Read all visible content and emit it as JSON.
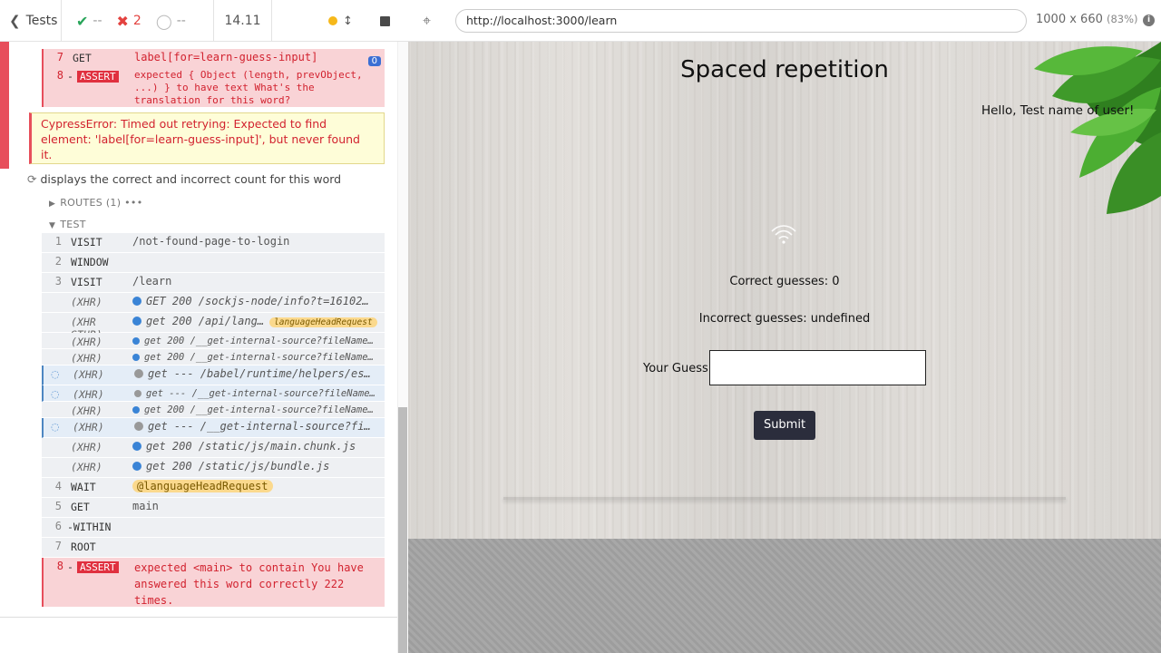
{
  "reporter": {
    "back_label": "Tests",
    "stats": {
      "passed": "--",
      "failed": "2",
      "pending": "--"
    },
    "duration": "14.11"
  },
  "commands_top": [
    {
      "num": "7",
      "name": "GET",
      "msg": "label[for=learn-guess-input]",
      "count": "0"
    },
    {
      "num": "8",
      "name": "ASSERT",
      "msg": "expected { Object (length, prevObject, ...) } to have text What's the translation for this word?"
    }
  ],
  "error": "CypressError: Timed out retrying: Expected to find element: 'label[for=learn-guess-input]', but never found it.",
  "test": {
    "title": "displays the correct and incorrect count for this word",
    "routes_label": "ROUTES (1)",
    "test_label": "TEST"
  },
  "commands": [
    {
      "num": "1",
      "name": "VISIT",
      "msg": "/not-found-page-to-login"
    },
    {
      "num": "2",
      "name": "WINDOW",
      "msg": ""
    },
    {
      "num": "3",
      "name": "VISIT",
      "msg": "/learn"
    },
    {
      "num": "",
      "name": "(XHR)",
      "msg": "GET 200 /sockjs-node/info?t=16102…"
    },
    {
      "num": "",
      "name": "(XHR STUB)",
      "msg": "get 200 /api/lang…",
      "alias": "languageHeadRequest"
    },
    {
      "num": "",
      "name": "(XHR)",
      "msg": "get 200 /__get-internal-source?fileName…"
    },
    {
      "num": "",
      "name": "(XHR)",
      "msg": "get 200 /__get-internal-source?fileName…"
    },
    {
      "num": "",
      "name": "(XHR)",
      "msg": "get --- /babel/runtime/helpers/es…"
    },
    {
      "num": "",
      "name": "(XHR)",
      "msg": "get --- /__get-internal-source?fileName…"
    },
    {
      "num": "",
      "name": "(XHR)",
      "msg": "get 200 /__get-internal-source?fileName…"
    },
    {
      "num": "",
      "name": "(XHR)",
      "msg": "get --- /__get-internal-source?fi…"
    },
    {
      "num": "",
      "name": "(XHR)",
      "msg": "get 200 /static/js/main.chunk.js"
    },
    {
      "num": "",
      "name": "(XHR)",
      "msg": "get 200 /static/js/bundle.js"
    },
    {
      "num": "4",
      "name": "WAIT",
      "msg": "@languageHeadRequest"
    },
    {
      "num": "5",
      "name": "GET",
      "msg": "main"
    },
    {
      "num": "6",
      "name": "-WITHIN",
      "msg": ""
    },
    {
      "num": "7",
      "name": "ROOT",
      "msg": ""
    },
    {
      "num": "8",
      "name": "ASSERT",
      "msg": "expected <main> to contain You have answered this word correctly 222 times."
    }
  ],
  "aut": {
    "url": "http://localhost:3000/learn",
    "viewport": "1000 x 660",
    "zoom": "(83%)",
    "app_title": "Spaced repetition",
    "greeting": "Hello, Test name of user!",
    "correct": "Correct guesses: 0",
    "incorrect": "Incorrect guesses: undefined",
    "guess_label": "Your Guess:",
    "submit_label": "Submit"
  },
  "colors": {
    "fail": "#e74e5b",
    "pass": "#29a55a",
    "accent_blue": "#3a84d6",
    "submit_bg": "#2b2d3c"
  }
}
